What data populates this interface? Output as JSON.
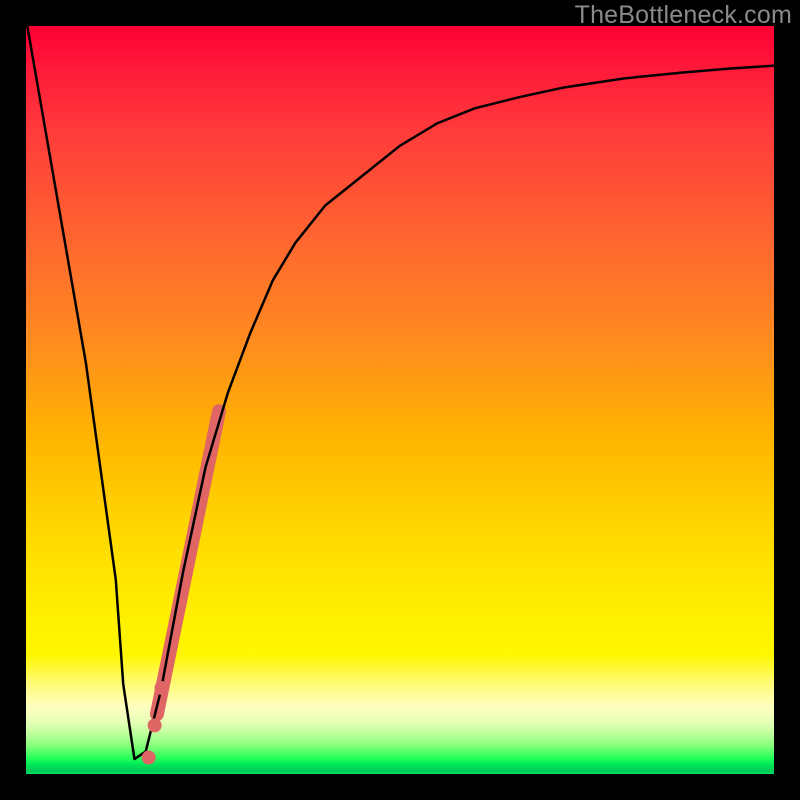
{
  "watermark": "TheBottleneck.com",
  "chart_data": {
    "type": "line",
    "title": "",
    "xlabel": "",
    "ylabel": "",
    "xlim": [
      0,
      100
    ],
    "ylim": [
      0,
      100
    ],
    "grid": false,
    "legend": false,
    "annotations": [],
    "series": [
      {
        "name": "bottleneck-curve",
        "x": [
          0,
          4,
          8,
          12,
          13,
          14.5,
          16,
          18,
          21,
          24,
          27,
          30,
          33,
          36,
          40,
          45,
          50,
          55,
          60,
          66,
          72,
          80,
          88,
          94,
          100
        ],
        "y": [
          101,
          78,
          55,
          26,
          12,
          2,
          3,
          11,
          27,
          41,
          51,
          59,
          66,
          71,
          76,
          80,
          84,
          87,
          89,
          90.5,
          91.8,
          93,
          93.8,
          94.3,
          94.7
        ],
        "color": "#000000",
        "stroke_width": 2.5
      },
      {
        "name": "highlight-segment",
        "x": [
          17.5,
          25.8
        ],
        "y": [
          8.0,
          48.5
        ],
        "color": "#e06666",
        "stroke_width": 14,
        "linecap": "round"
      }
    ],
    "markers": [
      {
        "x": 16.4,
        "y": 2.2,
        "r": 7,
        "color": "#e06666"
      },
      {
        "x": 17.2,
        "y": 6.5,
        "r": 7,
        "color": "#e06666"
      },
      {
        "x": 18.1,
        "y": 11.5,
        "r": 7,
        "color": "#e06666"
      }
    ]
  }
}
